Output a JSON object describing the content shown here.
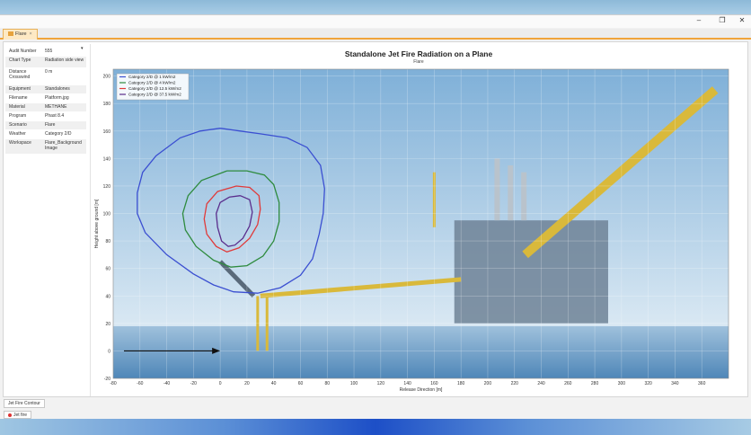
{
  "window": {
    "tab_label": "Flare",
    "tab_close": "×",
    "minimize_glyph": "–",
    "maximize_glyph": "❐",
    "close_glyph": "✕"
  },
  "properties": [
    {
      "key": "Audit Number",
      "value": "555"
    },
    {
      "key": "Chart Type",
      "value": "Radiation side view"
    },
    {
      "key": "Distance Crosswind",
      "value": "0 m"
    },
    {
      "key": "Equipment",
      "value": "Standalones"
    },
    {
      "key": "Filename",
      "value": "Platform.jpg"
    },
    {
      "key": "Material",
      "value": "METHANE"
    },
    {
      "key": "Program",
      "value": "Phast 8.4"
    },
    {
      "key": "Scenario",
      "value": "Flare"
    },
    {
      "key": "Weather",
      "value": "Category 2/D"
    },
    {
      "key": "Workspace",
      "value": "Flare_Background Image"
    }
  ],
  "pin_glyph": "▾",
  "bottom_tab_label": "Jet Fire Contour",
  "run_tab_label": "Jet fire",
  "colors": {
    "sky_top": "#7fb0d8",
    "sky_bottom": "#d9e8f3",
    "sea": "#4f87b8",
    "structure": "#d9b93b",
    "platform_body": "#6f8296"
  },
  "chart_data": {
    "type": "line",
    "title": "Standalone Jet Fire Radiation on a Plane",
    "subtitle": "Flare",
    "xlabel": "Release Direction [m]",
    "ylabel": "Height above ground [m]",
    "xlim": [
      -80,
      380
    ],
    "ylim": [
      -20,
      205
    ],
    "xticks": [
      -80,
      -60,
      -40,
      -20,
      0,
      20,
      40,
      60,
      80,
      100,
      120,
      140,
      160,
      180,
      200,
      220,
      240,
      260,
      280,
      300,
      320,
      340,
      360
    ],
    "yticks": [
      -20,
      0,
      20,
      40,
      60,
      80,
      100,
      120,
      140,
      160,
      180,
      200
    ],
    "grid": true,
    "legend_position": "top-left",
    "series": [
      {
        "name": "Category 2/D @ 1 kW/m2",
        "color": "#3b4fd1",
        "points": [
          [
            0,
            162
          ],
          [
            15,
            160
          ],
          [
            30,
            158
          ],
          [
            50,
            155
          ],
          [
            65,
            148
          ],
          [
            75,
            135
          ],
          [
            78,
            118
          ],
          [
            77,
            100
          ],
          [
            74,
            85
          ],
          [
            69,
            67
          ],
          [
            60,
            55
          ],
          [
            45,
            46
          ],
          [
            28,
            42
          ],
          [
            10,
            43
          ],
          [
            -5,
            48
          ],
          [
            -20,
            56
          ],
          [
            -40,
            70
          ],
          [
            -56,
            86
          ],
          [
            -62,
            100
          ],
          [
            -62,
            115
          ],
          [
            -58,
            130
          ],
          [
            -48,
            142
          ],
          [
            -30,
            155
          ],
          [
            -15,
            160
          ],
          [
            0,
            162
          ]
        ]
      },
      {
        "name": "Category 2/D @ 4 kW/m2",
        "color": "#2e8b3e",
        "points": [
          [
            5,
            131
          ],
          [
            20,
            131
          ],
          [
            33,
            128
          ],
          [
            40,
            121
          ],
          [
            44,
            108
          ],
          [
            44,
            94
          ],
          [
            40,
            80
          ],
          [
            32,
            69
          ],
          [
            20,
            62
          ],
          [
            8,
            61
          ],
          [
            -5,
            66
          ],
          [
            -18,
            76
          ],
          [
            -26,
            88
          ],
          [
            -28,
            100
          ],
          [
            -24,
            113
          ],
          [
            -14,
            124
          ],
          [
            5,
            131
          ]
        ]
      },
      {
        "name": "Category 2/D @ 12.5 kW/m2",
        "color": "#e03a3a",
        "points": [
          [
            12,
            120
          ],
          [
            22,
            119
          ],
          [
            29,
            113
          ],
          [
            30,
            103
          ],
          [
            28,
            92
          ],
          [
            22,
            82
          ],
          [
            14,
            75
          ],
          [
            5,
            72
          ],
          [
            -3,
            76
          ],
          [
            -10,
            85
          ],
          [
            -12,
            96
          ],
          [
            -10,
            107
          ],
          [
            -2,
            116
          ],
          [
            12,
            120
          ]
        ]
      },
      {
        "name": "Category 2/D @ 37.5 kW/m2",
        "color": "#5a2d8c",
        "points": [
          [
            15,
            113
          ],
          [
            22,
            110
          ],
          [
            24,
            101
          ],
          [
            22,
            91
          ],
          [
            17,
            82
          ],
          [
            11,
            77
          ],
          [
            6,
            76
          ],
          [
            1,
            80
          ],
          [
            -2,
            90
          ],
          [
            -3,
            100
          ],
          [
            0,
            108
          ],
          [
            7,
            112
          ],
          [
            15,
            113
          ]
        ]
      }
    ],
    "annotations": [
      {
        "type": "arrow",
        "from": [
          -80,
          0
        ],
        "to": [
          0,
          0
        ],
        "color": "#111111"
      }
    ],
    "background_image": "offshore-platform-photo"
  }
}
